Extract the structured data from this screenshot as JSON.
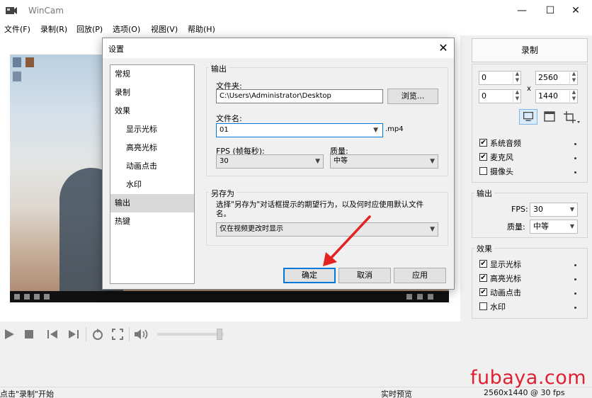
{
  "window": {
    "title": "WinCam",
    "controls": {
      "minimize": "—",
      "maximize": "☐",
      "close": "✕"
    }
  },
  "menu": [
    "文件(F)",
    "录制(R)",
    "回放(P)",
    "选项(O)",
    "视图(V)",
    "帮助(H)"
  ],
  "right_panel": {
    "record_label": "录制",
    "region": {
      "x": "0",
      "y": "0",
      "width": "2560",
      "height": "1440",
      "separator": "x"
    },
    "sources": [
      {
        "label": "系统音频",
        "checked": true
      },
      {
        "label": "麦克风",
        "checked": true
      },
      {
        "label": "摄像头",
        "checked": false
      }
    ],
    "output": {
      "title": "输出",
      "fps_label": "FPS:",
      "fps_value": "30",
      "quality_label": "质量:",
      "quality_value": "中等"
    },
    "effects": {
      "title": "效果",
      "items": [
        {
          "label": "显示光标",
          "checked": true
        },
        {
          "label": "高亮光标",
          "checked": true
        },
        {
          "label": "动画点击",
          "checked": true
        },
        {
          "label": "水印",
          "checked": false
        }
      ]
    }
  },
  "dialog": {
    "title": "设置",
    "close": "✕",
    "nav": [
      {
        "label": "常规",
        "indent": false,
        "selected": false
      },
      {
        "label": "录制",
        "indent": false,
        "selected": false
      },
      {
        "label": "效果",
        "indent": false,
        "selected": false
      },
      {
        "label": "显示光标",
        "indent": true,
        "selected": false
      },
      {
        "label": "高亮光标",
        "indent": true,
        "selected": false
      },
      {
        "label": "动画点击",
        "indent": true,
        "selected": false
      },
      {
        "label": "水印",
        "indent": true,
        "selected": false
      },
      {
        "label": "输出",
        "indent": false,
        "selected": true
      },
      {
        "label": "热键",
        "indent": false,
        "selected": false
      }
    ],
    "output": {
      "legend": "输出",
      "folder_label": "文件夹:",
      "folder_value": "C:\\Users\\Administrator\\Desktop",
      "browse_label": "浏览...",
      "filename_label": "文件名:",
      "filename_value": "01",
      "extension": ".mp4",
      "fps_label": "FPS (帧每秒):",
      "fps_value": "30",
      "quality_label": "质量:",
      "quality_value": "中等"
    },
    "save_as": {
      "legend": "另存为",
      "description": "选择\"另存为\"对话框提示的期望行为，以及何时应使用默认文件名。",
      "option_value": "仅在视频更改时显示"
    },
    "buttons": {
      "ok": "确定",
      "cancel": "取消",
      "apply": "应用"
    }
  },
  "status": {
    "left": "点击\"录制\"开始",
    "middle": "实时预览",
    "right": "2560x1440 @ 30 fps"
  },
  "watermark": "fubaya.com",
  "colors": {
    "accent": "#0078d7",
    "arrow": "#e32222",
    "watermark": "#e02030"
  }
}
